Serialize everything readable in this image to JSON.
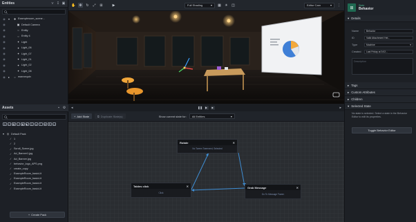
{
  "entities": {
    "title": "Entities",
    "search_placeholder": "",
    "items": [
      {
        "label": "Exampleroom_scene...",
        "icon": "cube-icon"
      },
      {
        "label": "Default Camera",
        "icon": "camera-icon"
      },
      {
        "label": "Entity",
        "icon": "entity-icon"
      },
      {
        "label": "Entity 4",
        "icon": "entity-icon"
      },
      {
        "label": "Light",
        "icon": "bulb-icon"
      },
      {
        "label": "Light_06",
        "icon": "bulb-icon"
      },
      {
        "label": "Light_07",
        "icon": "bulb-icon"
      },
      {
        "label": "Light_01",
        "icon": "bulb-icon"
      },
      {
        "label": "Light_02",
        "icon": "bulb-icon"
      },
      {
        "label": "Light_08",
        "icon": "bulb-icon"
      },
      {
        "label": "mannequin",
        "icon": "person-icon"
      }
    ]
  },
  "assets": {
    "title": "Assets",
    "search_placeholder": "",
    "items": [
      {
        "label": "Default Pack",
        "icon": "pack-icon"
      },
      {
        "label": "1",
        "icon": "file-icon"
      },
      {
        "label": "2",
        "icon": "file-icon"
      },
      {
        "label": "Scroll_Scene.jpg",
        "icon": "file-icon"
      },
      {
        "label": "Ad_Banner1.jpg",
        "icon": "file-icon"
      },
      {
        "label": "Ad_Banner.jpg",
        "icon": "file-icon"
      },
      {
        "label": "behavior_logo_APS.png",
        "icon": "file-icon"
      },
      {
        "label": "create_copy",
        "icon": "file-icon"
      },
      {
        "label": "ExampleRoom_basicLit",
        "icon": "file-icon"
      },
      {
        "label": "ExampleRoom_basicLit",
        "icon": "file-icon"
      },
      {
        "label": "ExampleRoom_basicLit",
        "icon": "file-icon"
      },
      {
        "label": "ExampleRoom_basicLit",
        "icon": "file-icon"
      }
    ],
    "create_button": "Create Pack"
  },
  "toolbar": {
    "shading": "Full Shading",
    "camera": "Editor Cam"
  },
  "behavior_toolbar": {
    "add_state": "Add State",
    "duplicate_state": "Duplicate State(s)",
    "show_label": "Show current state for:",
    "entity_select": "All Entities"
  },
  "nodes": {
    "rotate": {
      "title": "Rotate",
      "body": "No Tween Tweenerd, Selected"
    },
    "tables_click": {
      "title": "Tables click",
      "body": "Click"
    },
    "grab_message": {
      "title": "Grab Message",
      "body": "Go To Message Tween"
    }
  },
  "inspector": {
    "header_small": "State",
    "header_title": "Behavior",
    "details_label": "Details",
    "fields": [
      {
        "label": "Name",
        "value": "Behavior"
      },
      {
        "label": "ID",
        "value": "Valid Attachment Het..."
      },
      {
        "label": "Type",
        "value": "Machine"
      },
      {
        "label": "Created",
        "value": "Last Friday at 3:02..."
      }
    ],
    "description_placeholder": "Description",
    "sections": [
      "Tags",
      "Custom Attributes",
      "Children"
    ],
    "selected_state_label": "Selected State",
    "selected_state_note": "No state is selected. Select a state in the Behavior Editor to edit its properties.",
    "toggle_button": "Toggle Behavior Editor"
  }
}
